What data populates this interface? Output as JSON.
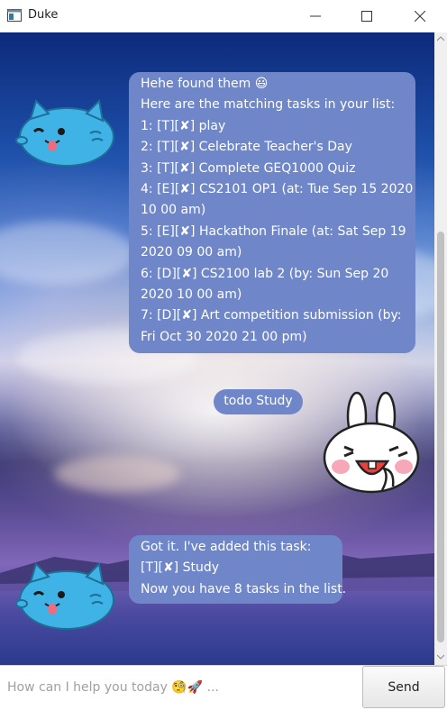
{
  "window": {
    "title": "Duke"
  },
  "messages": [
    {
      "sender": "duke",
      "lines": [
        "Hehe found them 😃",
        "Here are the matching tasks in your list:",
        "1: [T][✘] play",
        "2: [T][✘] Celebrate Teacher's Day",
        "3: [T][✘] Complete GEQ1000 Quiz",
        "4: [E][✘] CS2101 OP1  (at: Tue Sep 15 2020",
        "10 00 am)",
        "5: [E][✘] Hackathon Finale  (at: Sat Sep 19",
        "2020 09 00 am)",
        "6: [D][✘] CS2100 lab 2  (by: Sun Sep 20",
        "2020 10 00 am)",
        "7: [D][✘] Art competition submission  (by:",
        "Fri Oct 30 2020 21 00 pm)"
      ]
    },
    {
      "sender": "user",
      "text": "todo Study"
    },
    {
      "sender": "duke",
      "lines": [
        "Got it. I've added this task:",
        "[T][✘] Study",
        "Now you have 8 tasks in the list."
      ]
    }
  ],
  "input": {
    "placeholder": "How can I help you today 🧐🚀 ...",
    "value": ""
  },
  "send_label": "Send",
  "icons": {
    "duke_avatar": "blue-cat-avatar-icon",
    "user_avatar": "white-bunny-avatar-icon",
    "app": "java-window-icon"
  },
  "colors": {
    "bubble": "#6f87c8",
    "cat": "#3fb3e6",
    "bunny_blush": "#f7a8b8"
  }
}
